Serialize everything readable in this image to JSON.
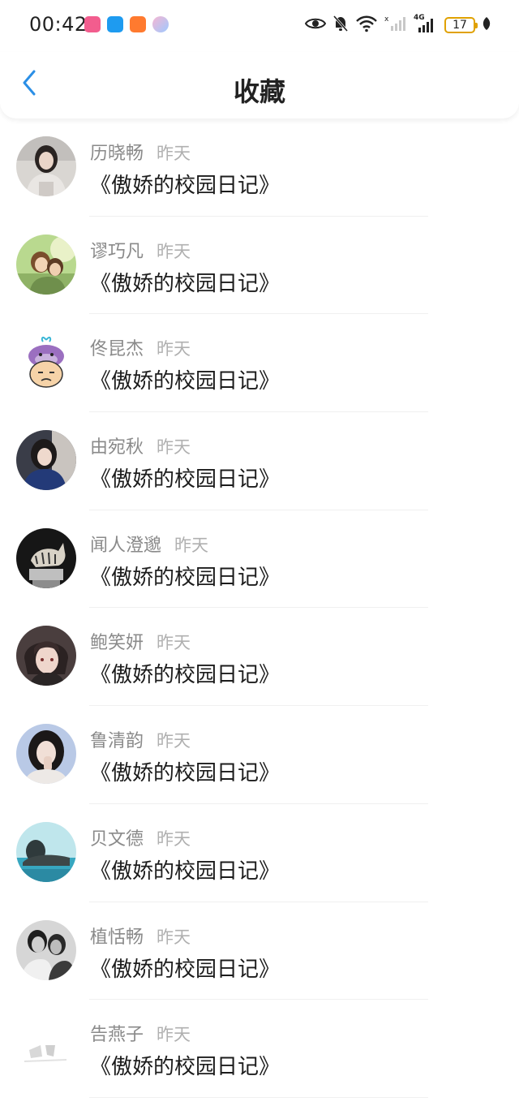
{
  "status_bar": {
    "time": "00:42",
    "network": "4G",
    "battery": "17"
  },
  "header": {
    "title": "收藏"
  },
  "favorites": [
    {
      "name": "历晓畅",
      "time": "昨天",
      "title": "《傲娇的校园日记》",
      "avatar": "avatar-photo-girl"
    },
    {
      "name": "谬巧凡",
      "time": "昨天",
      "title": "《傲娇的校园日记》",
      "avatar": "avatar-anime-couple"
    },
    {
      "name": "佟昆杰",
      "time": "昨天",
      "title": "《傲娇的校园日记》",
      "avatar": "avatar-cartoon-whale"
    },
    {
      "name": "由宛秋",
      "time": "昨天",
      "title": "《傲娇的校园日记》",
      "avatar": "avatar-photo-girl-dark"
    },
    {
      "name": "闻人澄邈",
      "time": "昨天",
      "title": "《傲娇的校园日记》",
      "avatar": "avatar-tiger-statue"
    },
    {
      "name": "鲍笑妍",
      "time": "昨天",
      "title": "《傲娇的校园日记》",
      "avatar": "avatar-anime-boy"
    },
    {
      "name": "鲁清韵",
      "time": "昨天",
      "title": "《傲娇的校园日记》",
      "avatar": "avatar-photo-girl-hand"
    },
    {
      "name": "贝文德",
      "time": "昨天",
      "title": "《傲娇的校园日记》",
      "avatar": "avatar-buddha-water"
    },
    {
      "name": "植恬畅",
      "time": "昨天",
      "title": "《傲娇的校园日记》",
      "avatar": "avatar-bw-couple"
    },
    {
      "name": "告燕子",
      "time": "昨天",
      "title": "《傲娇的校园日记》",
      "avatar": "avatar-white-sketch"
    }
  ],
  "colors": {
    "accent": "#2b8fe6",
    "text_primary": "#1c1c1c",
    "text_secondary": "#8a8a8a",
    "text_tertiary": "#b0b0b0",
    "battery": "#e0a100"
  }
}
